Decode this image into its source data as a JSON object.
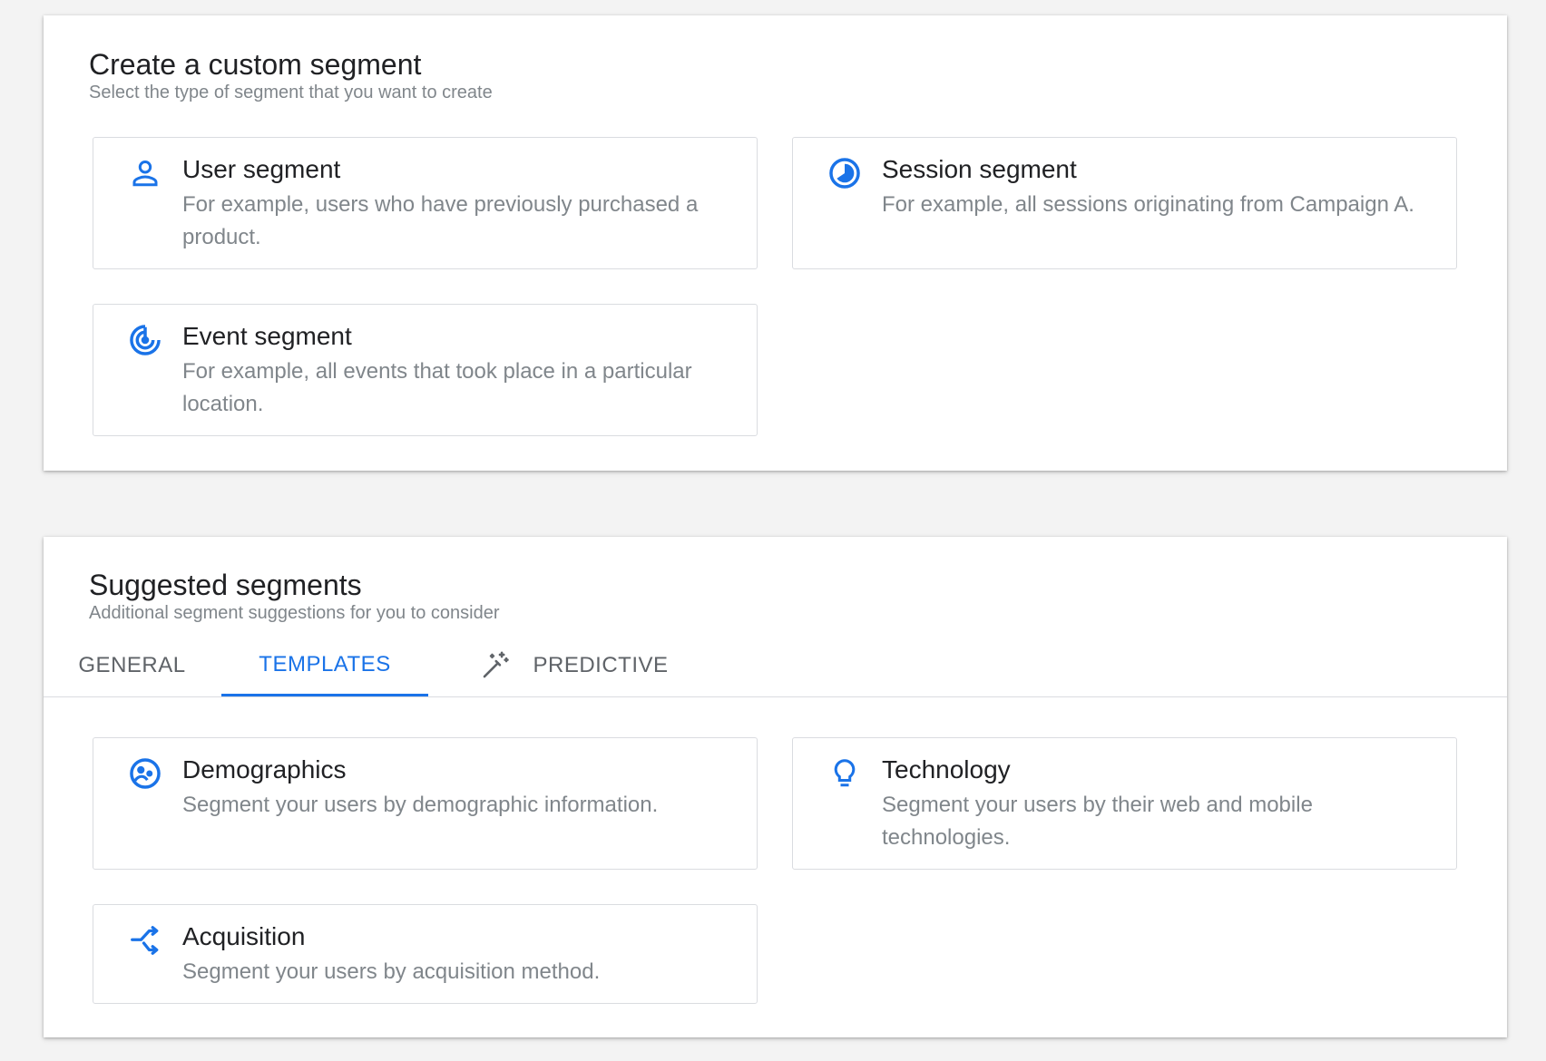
{
  "custom": {
    "title": "Create a custom segment",
    "subtitle": "Select the type of segment that you want to create",
    "cards": [
      {
        "icon": "person-icon",
        "title": "User segment",
        "desc": "For example, users who have previously purchased a product."
      },
      {
        "icon": "session-pie-icon",
        "title": "Session segment",
        "desc": "For example, all sessions originating from Campaign A."
      },
      {
        "icon": "event-target-icon",
        "title": "Event segment",
        "desc": "For example, all events that took place in a particular location."
      }
    ]
  },
  "suggested": {
    "title": "Suggested segments",
    "subtitle": "Additional segment suggestions for you to consider",
    "tabs": [
      {
        "label": "GENERAL",
        "active": false
      },
      {
        "label": "TEMPLATES",
        "active": true
      },
      {
        "label": "PREDICTIVE",
        "active": false,
        "icon": "magic-wand-icon"
      }
    ],
    "cards": [
      {
        "icon": "demographics-icon",
        "title": "Demographics",
        "desc": "Segment your users by demographic information."
      },
      {
        "icon": "lightbulb-icon",
        "title": "Technology",
        "desc": "Segment your users by their web and mobile technologies."
      },
      {
        "icon": "acquisition-icon",
        "title": "Acquisition",
        "desc": "Segment your users by acquisition method."
      }
    ]
  },
  "colors": {
    "accent": "#1a73e8",
    "text": "#202124",
    "muted": "#80868b",
    "border": "#dadce0",
    "background": "#f3f3f3"
  }
}
